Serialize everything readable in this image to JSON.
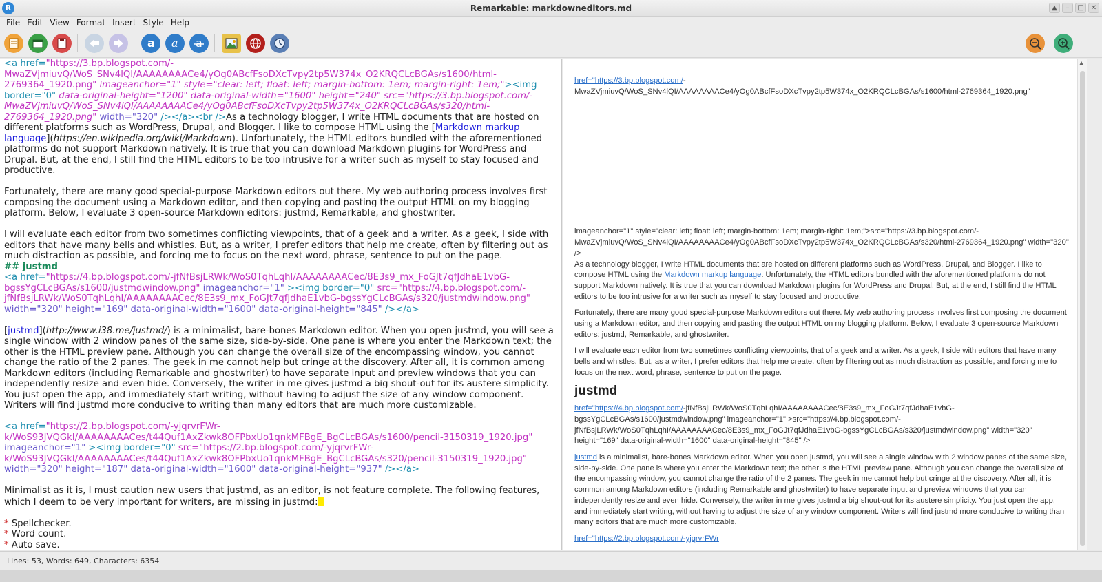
{
  "window": {
    "title": "Remarkable: markdowneditors.md",
    "app_icon_letter": "R"
  },
  "menu": [
    "File",
    "Edit",
    "View",
    "Format",
    "Insert",
    "Style",
    "Help"
  ],
  "toolbar": {
    "new_icon": "new-document-icon",
    "open_icon": "open-folder-icon",
    "save_icon": "save-icon",
    "undo_icon": "undo-arrow-icon",
    "redo_icon": "redo-arrow-icon",
    "bold_icon": "bold-a-icon",
    "italic_icon": "italic-a-icon",
    "strike_icon": "strikethrough-a-icon",
    "image_icon": "insert-image-icon",
    "link_icon": "insert-link-globe-icon",
    "time_icon": "insert-time-clock-icon",
    "zoom_out_icon": "zoom-out-icon",
    "zoom_in_icon": "zoom-in-icon"
  },
  "editor": {
    "p1_tag": "<a href=",
    "p1_url1": "\"https://3.bp.blogspot.com/-MwaZVjmiuvQ/WoS_SNv4lQI/AAAAAAAACe4/yOg0ABcfFsoDXcTvpy2tp5W374x_O2KRQCLcBGAs/s1600/html-2769364_1920.png\"",
    "p1_rest1": " imageanchor=\"1\" style=\"clear: left; float: left; margin-bottom: 1em; margin-right: 1em;\"",
    "p1_tag2": "><img border=\"0\"",
    "p1_rest2": " data-original-height=\"1200\" data-original-width=\"1600\" height=\"240\" src=\"https://3.bp.blogspot.com/-MwaZVjmiuvQ/WoS_SNv4lQI/AAAAAAAACe4/yOg0ABcfFsoDXcTvpy2tp5W374x_O2KRQCLcBGAs/s320/html-2769364_1920.png\"",
    "p1_width": " width=\"320\"",
    "p1_close": " /></a><br />",
    "p1_text1": "As a technology blogger, I write HTML documents that are hosted on different platforms such as WordPress, Drupal, and Blogger. I like to compose HTML using the [",
    "p1_link": "Markdown markup language",
    "p1_mid": "](",
    "p1_link_url": "https://en.wikipedia.org/wiki/Markdown",
    "p1_text2": "). Unfortunately, the HTML editors bundled with the aforementioned platforms do not support Markdown natively. It is true that you can download Markdown plugins for WordPress and Drupal. But, at the end, I still find  the HTML editors to be too intrusive for a writer such as myself to stay focused and productive.",
    "p2": "Fortunately, there are many good special-purpose Markdown editors out there. My web authoring process involves first composing the document using a Markdown editor, and then copying and pasting the output HTML on my blogging platform. Below, I evaluate  3 open-source Markdown editors: justmd, Remarkable, and ghostwriter.",
    "p3": "I will evaluate each editor from two sometimes conflicting viewpoints, that of a geek and a writer. As a geek, I side with editors that have many bells and whistles. But, as a writer, I prefer editors that help me create, often by filtering out as much distraction as possible, and forcing me to focus on the next word, phrase, sentence to put on the page.",
    "heading": "## justmd",
    "p4_tag": "<a href=",
    "p4_url1": "\"https://4.bp.blogspot.com/-jfNfBsjLRWk/WoS0TqhLqhI/AAAAAAAACec/8E3s9_mx_FoGJt7qfJdhaE1vbG-bgssYgCLcBGAs/s1600/justmdwindow.png\"",
    "p4_rest1": " imageanchor=\"1\" ",
    "p4_tag2": "><img border=\"0\"",
    "p4_src": " src=\"https://4.bp.blogspot.com/-jfNfBsjLRWk/WoS0TqhLqhI/AAAAAAAACec/8E3s9_mx_FoGJt7qfJdhaE1vbG-bgssYgCLcBGAs/s320/justmdwindow.png\"",
    "p4_attrs": " width=\"320\" height=\"169\" data-original-width=\"1600\" data-original-height=\"845\"",
    "p4_close": " /></a>",
    "p5_open": "[",
    "p5_link": "justmd",
    "p5_mid": "](",
    "p5_link_url": "http://www.i38.me/justmd/",
    "p5_text": ") is a minimalist, bare-bones Markdown editor. When you open justmd, you will see a single window with 2 window panes of the same size, side-by-side. One pane is where you enter the Markdown text; the other is the HTML preview pane. Although you can change the overall size of the encompassing window, you cannot change the ratio of the 2 panes. The geek in me cannot help but cringe at the discovery. After all, it is common among Markdown editors (including Remarkable and ghostwriter) to have separate input and preview windows that you can independently resize and even hide. Conversely, the writer in me gives justmd a big shout-out for its austere simplicity. You just open the app, and immediately start writing, without having to adjust the size of any window component. Writers will find justmd more conducive to writing than many editors that are much more customizable.",
    "p6_tag": "<a href=",
    "p6_url1": "\"https://2.bp.blogspot.com/-yjqrvrFWr-k/WoS93JVQGkI/AAAAAAAACes/t44Quf1AxZkwk8OFPbxUo1qnkMFBgE_BgCLcBGAs/s1600/pencil-3150319_1920.jpg\"",
    "p6_rest1": " imageanchor=\"1\" ",
    "p6_tag2": "><img border=\"0\"",
    "p6_src": " src=\"https://2.bp.blogspot.com/-yjqrvrFWr-k/WoS93JVQGkI/AAAAAAAACes/t44Quf1AxZkwk8OFPbxUo1qnkMFBgE_BgCLcBGAs/s320/pencil-3150319_1920.jpg\"",
    "p6_attrs": " width=\"320\" height=\"187\" data-original-width=\"1600\" data-original-height=\"937\"",
    "p6_close": " /></a>",
    "p7": "Minimalist as it is, I must caution new users that justmd, as an editor, is not feature complete. The following features, which I deem to be very important for writers, are missing in justmd:",
    "bullet_marker": "*",
    "bullets": [
      "Spellchecker.",
      "Word count.",
      "Auto save."
    ]
  },
  "preview": {
    "p1_link": "href=\"https://3.bp.blogspot.com/",
    "p1_rest": "-MwaZVjmiuvQ/WoS_SNv4lQI/AAAAAAAACe4/yOg0ABcfFsoDXcTvpy2tp5W374x_O2KRQCLcBGAs/s1600/html-2769364_1920.png\"",
    "p2": "imageanchor=\"1\" style=\"clear: left; float: left; margin-bottom: 1em; margin-right: 1em;\">src=\"https://3.bp.blogspot.com/-MwaZVjmiuvQ/WoS_SNv4lQI/AAAAAAAACe4/yOg0ABcfFsoDXcTvpy2tp5W374x_O2KRQCLcBGAs/s320/html-2769364_1920.png\" width=\"320\" />",
    "p3_a": "As a technology blogger, I write HTML documents that are hosted on different platforms such as WordPress, Drupal, and Blogger. I like to compose HTML using the ",
    "p3_link": "Markdown markup language",
    "p3_b": ". Unfortunately, the HTML editors bundled with the aforementioned platforms do not support Markdown natively. It is true that you can download Markdown plugins for WordPress and Drupal. But, at the end, I still find the HTML editors to be too intrusive for a writer such as myself to stay focused and productive.",
    "p4": "Fortunately, there are many good special-purpose Markdown editors out there. My web authoring process involves first composing the document using a Markdown editor, and then copying and pasting the output HTML on my blogging platform. Below, I evaluate 3 open-source Markdown editors: justmd, Remarkable, and ghostwriter.",
    "p5": "I will evaluate each editor from two sometimes conflicting viewpoints, that of a geek and a writer. As a geek, I side with editors that have many bells and whistles. But, as a writer, I prefer editors that help me create, often by filtering out as much distraction as possible, and forcing me to focus on the next word, phrase, sentence to put on the page.",
    "heading": "justmd",
    "p6_link": "href=\"https://4.bp.blogspot.com/",
    "p6_rest": "-jfNfBsjLRWk/WoS0TqhLqhI/AAAAAAAACec/8E3s9_mx_FoGJt7qfJdhaE1vbG-bgssYgCLcBGAs/s1600/justmdwindow.png\" imageanchor=\"1\" >src=\"https://4.bp.blogspot.com/-jfNfBsjLRWk/WoS0TqhLqhI/AAAAAAAACec/8E3s9_mx_FoGJt7qfJdhaE1vbG-bgssYgCLcBGAs/s320/justmdwindow.png\" width=\"320\" height=\"169\" data-original-width=\"1600\" data-original-height=\"845\" />",
    "p7_link": "justmd",
    "p7_rest": " is a minimalist, bare-bones Markdown editor. When you open justmd, you will see a single window with 2 window panes of the same size, side-by-side. One pane is where you enter the Markdown text; the other is the HTML preview pane. Although you can change the overall size of the encompassing window, you cannot change the ratio of the 2 panes. The geek in me cannot help but cringe at the discovery. After all, it is common among Markdown editors (including Remarkable and ghostwriter) to have separate input and preview windows that you can independently resize and even hide. Conversely, the writer in me gives justmd a big shout-out for its austere simplicity. You just open the app, and immediately start writing, without having to adjust the size of any window component. Writers will find justmd more conducive to writing than many editors that are much more customizable.",
    "p8_cut": "href=\"https://2.bp.blogspot.com/-yjqrvrFWr"
  },
  "status": "Lines: 53, Words: 649, Characters: 6354"
}
